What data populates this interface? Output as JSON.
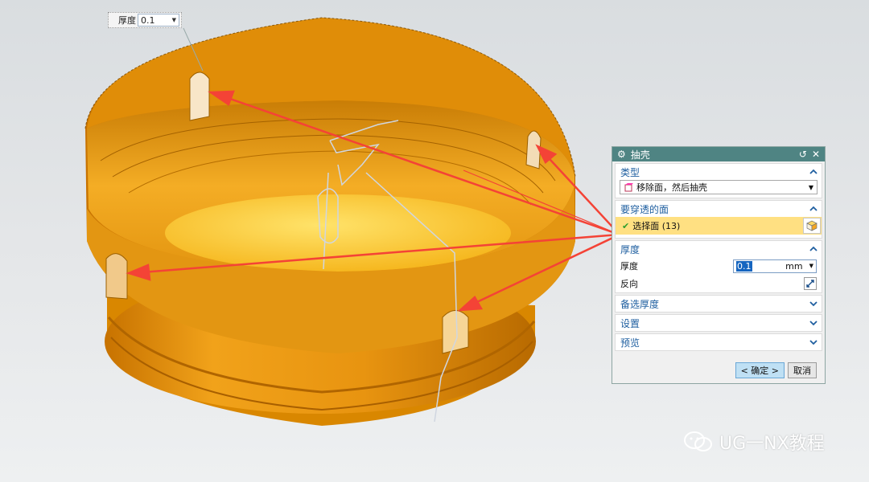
{
  "floating_input": {
    "label": "厚度",
    "value": "0.1"
  },
  "dialog": {
    "title": "抽壳",
    "sections": {
      "type": {
        "header": "类型",
        "value": "移除面，然后抽壳"
      },
      "pierce": {
        "header": "要穿透的面",
        "select_label": "选择面 (13)"
      },
      "thickness": {
        "header": "厚度",
        "field_label": "厚度",
        "value": "0.1",
        "unit": "mm",
        "reverse_label": "反向"
      },
      "alt": {
        "header": "备选厚度"
      },
      "settings": {
        "header": "设置"
      },
      "preview": {
        "header": "预览"
      }
    },
    "buttons": {
      "ok": "< 确定 >",
      "cancel": "取消"
    }
  },
  "watermark": "UG一NX教程",
  "colors": {
    "part": "#f39c12",
    "titlebar": "#4f8483",
    "selection": "#ffe082",
    "arrow": "#f44336"
  }
}
